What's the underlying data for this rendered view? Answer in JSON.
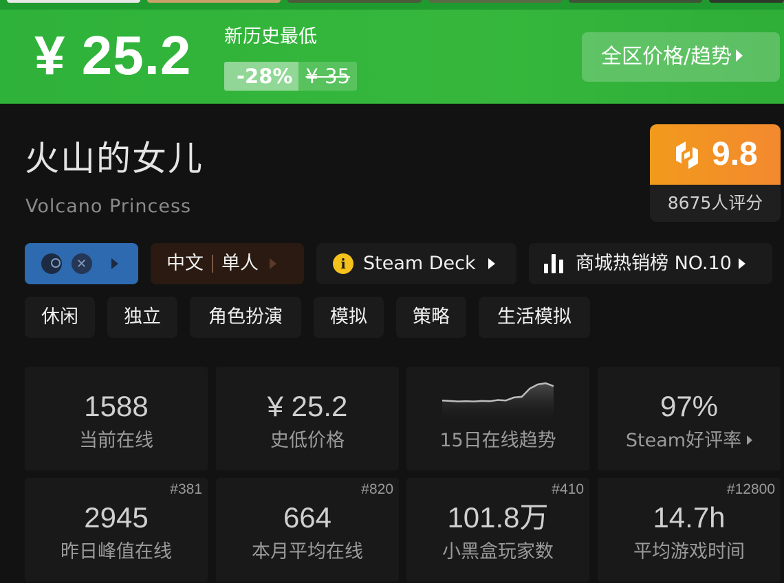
{
  "price": {
    "current": "¥ 25.2",
    "tag": "新历史最低",
    "discount": "-28%",
    "original": "¥ 35",
    "region_button": "全区价格/趋势"
  },
  "game": {
    "title": "火山的女儿",
    "subtitle": "Volcano Princess"
  },
  "score": {
    "value": "9.8",
    "count": "8675人评分"
  },
  "chips": {
    "lang": "中文",
    "mode": "单人",
    "deck": "Steam Deck",
    "rank": "商城热销榜 NO.10"
  },
  "tags": [
    "休闲",
    "独立",
    "角色扮演",
    "模拟",
    "策略",
    "生活模拟"
  ],
  "stats": [
    {
      "value": "1588",
      "label": "当前在线",
      "rank": ""
    },
    {
      "value": "¥ 25.2",
      "label": "史低价格",
      "rank": ""
    },
    {
      "value": "",
      "label": "15日在线趋势",
      "rank": ""
    },
    {
      "value": "97%",
      "label": "Steam好评率",
      "rank": ""
    },
    {
      "value": "2945",
      "label": "昨日峰值在线",
      "rank": "#381"
    },
    {
      "value": "664",
      "label": "本月平均在线",
      "rank": "#820"
    },
    {
      "value": "101.8万",
      "label": "小黑盒玩家数",
      "rank": "#410"
    },
    {
      "value": "14.7h",
      "label": "平均游戏时间",
      "rank": "#12800"
    }
  ],
  "trend_points": [
    0.3,
    0.28,
    0.26,
    0.27,
    0.26,
    0.28,
    0.27,
    0.32,
    0.3,
    0.42,
    0.45,
    0.78,
    0.95,
    1.0,
    0.88
  ],
  "colors": {
    "banner_green": "#36b73c",
    "score_orange": "#f3892f",
    "platform_blue": "#2d6ab0",
    "info_yellow": "#f5c21b"
  },
  "icons": {
    "platform": [
      "steam-icon",
      "xbox-icon"
    ],
    "deck": "info-icon",
    "rank": "bar-chart-icon",
    "score_logo": "heybox-logo-icon"
  }
}
